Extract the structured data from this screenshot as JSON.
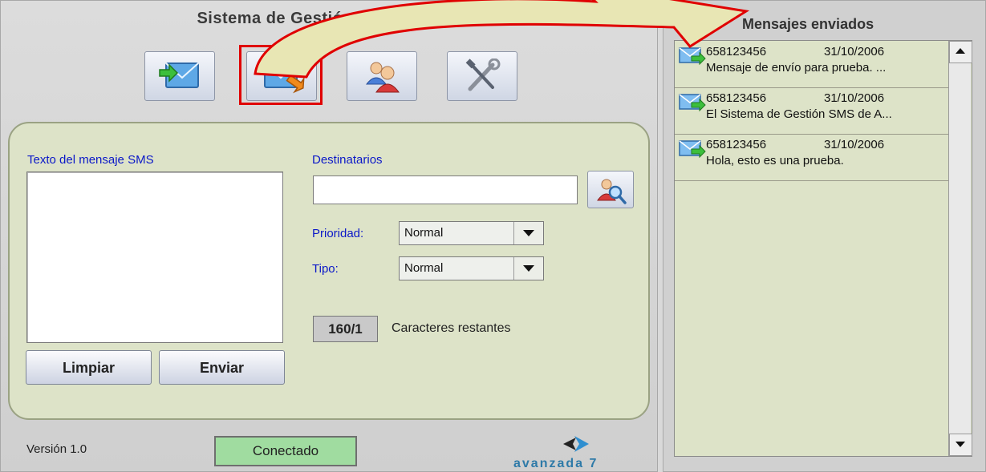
{
  "app": {
    "title": "Sistema de Gestión SMS Lite",
    "version": "Versión 1.0",
    "status": "Conectado",
    "logo_text": "avanzada 7"
  },
  "toolbar": {
    "items": [
      {
        "icon": "inbox-icon",
        "label": ""
      },
      {
        "icon": "send-sms-icon",
        "label": ""
      },
      {
        "icon": "contacts-icon",
        "label": ""
      },
      {
        "icon": "settings-icon",
        "label": ""
      }
    ]
  },
  "compose": {
    "message_label": "Texto del mensaje SMS",
    "message_value": "",
    "clear_label": "Limpiar",
    "send_label": "Enviar",
    "recipients_label": "Destinatarios",
    "recipients_value": "",
    "priority_label": "Prioridad:",
    "priority_value": "Normal",
    "type_label": "Tipo:",
    "type_value": "Normal",
    "counter": "160/1",
    "counter_label": "Caracteres restantes"
  },
  "sent": {
    "title": "Mensajes enviados",
    "messages": [
      {
        "number": "658123456",
        "date": "31/10/2006",
        "text": "Mensaje de envío para prueba. ..."
      },
      {
        "number": "658123456",
        "date": "31/10/2006",
        "text": "El Sistema de Gestión SMS de A..."
      },
      {
        "number": "658123456",
        "date": "31/10/2006",
        "text": "Hola, esto es una prueba."
      }
    ]
  },
  "colors": {
    "panel": "#dde3c8",
    "label_blue": "#0b18c8",
    "status_green": "#a0dca0",
    "highlight_red": "#e00000",
    "callout_fill": "#e8e6b4"
  }
}
